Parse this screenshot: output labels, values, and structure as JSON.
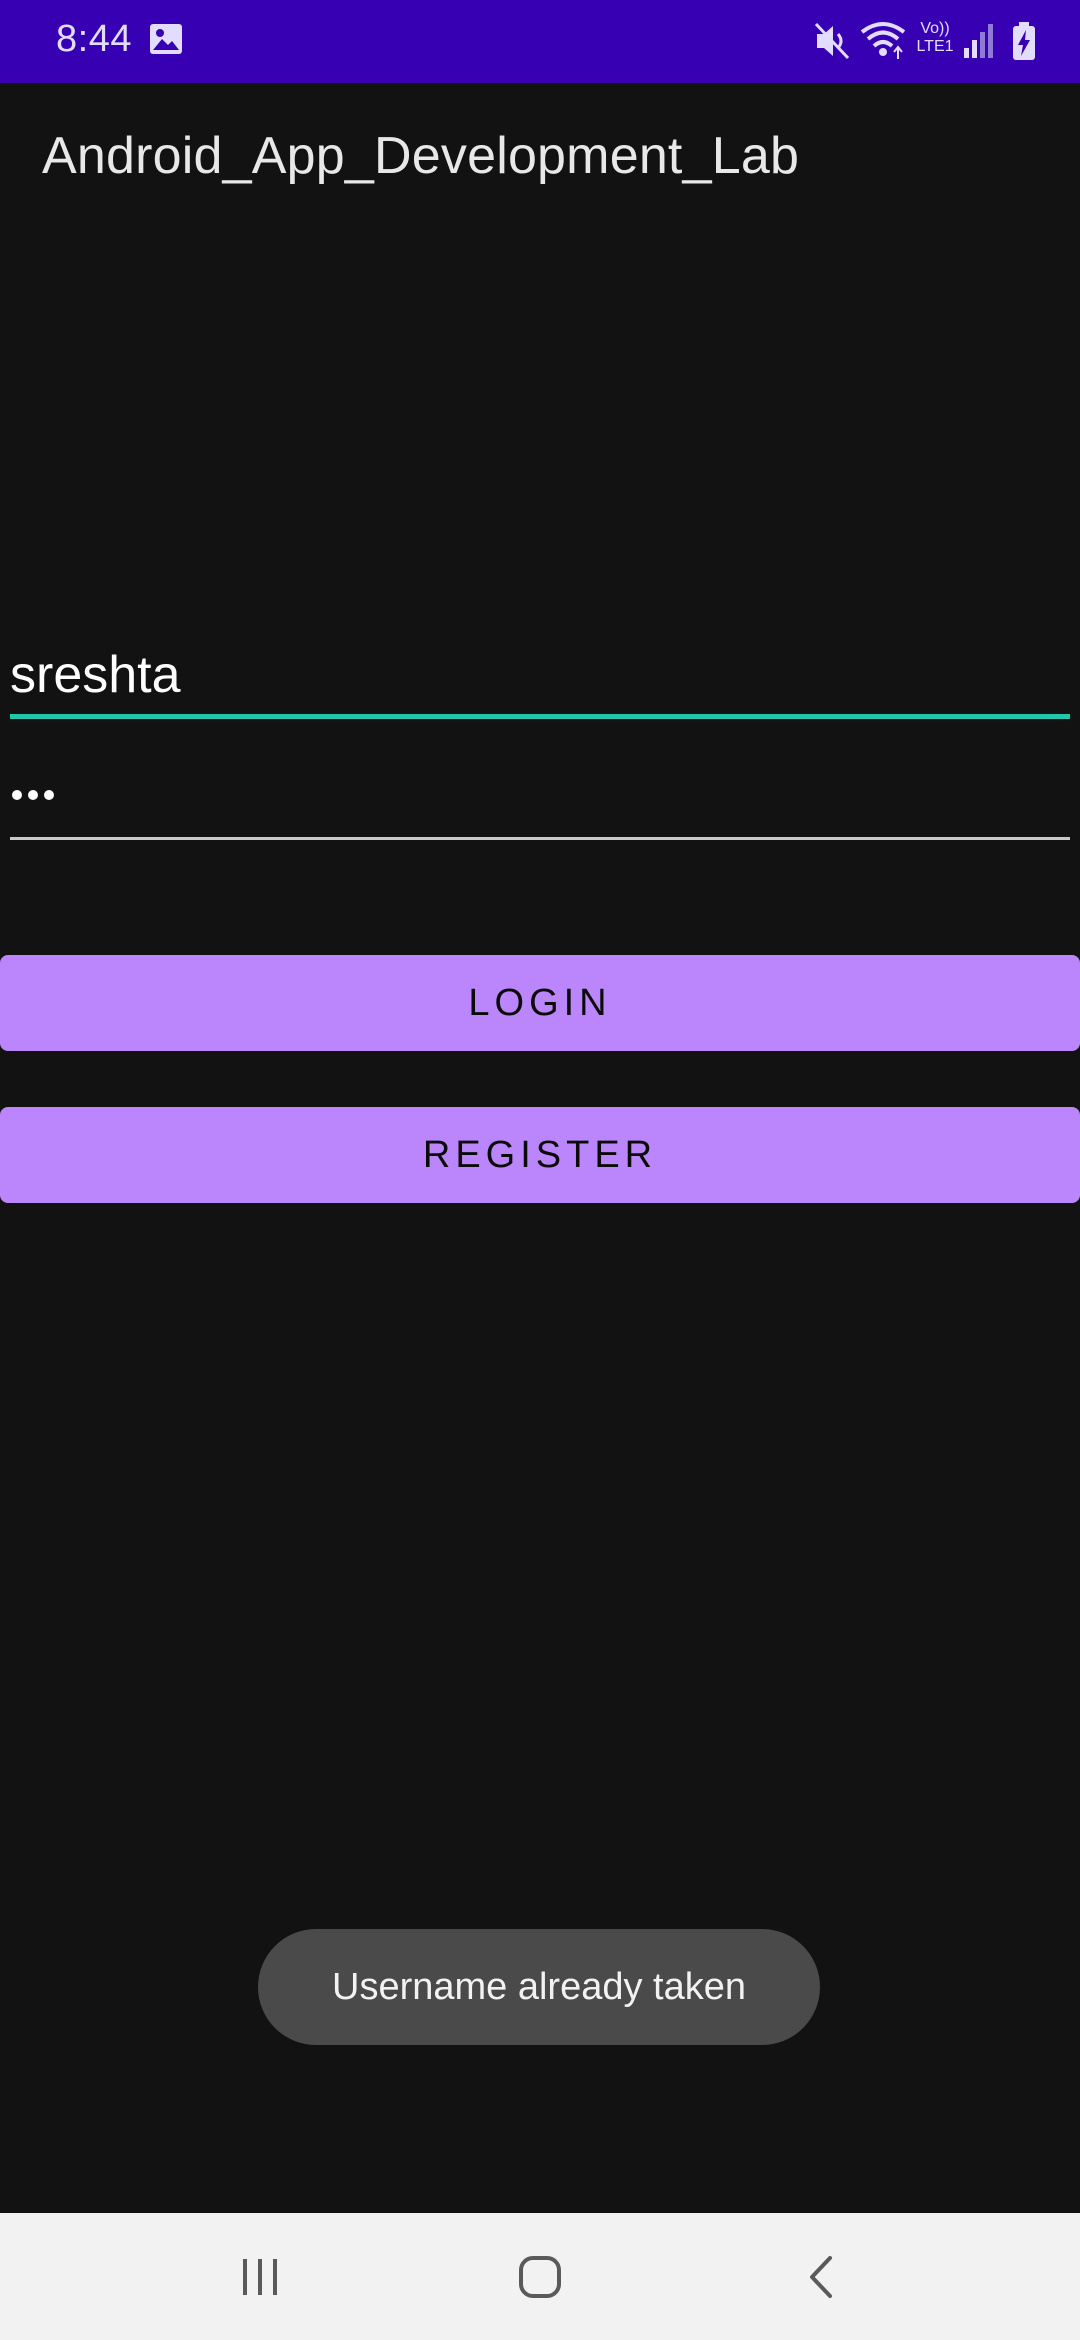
{
  "status_bar": {
    "time": "8:44",
    "icons": [
      "gallery-icon",
      "mute-icon",
      "wifi-icon",
      "volte-lte-icon",
      "signal-icon",
      "battery-charging-icon"
    ],
    "network_label_top": "Vo))",
    "network_label_bottom": "LTE1",
    "color": "#3700b3"
  },
  "app": {
    "title": "Android_App_Development_Lab"
  },
  "form": {
    "username_value": "sreshta",
    "password_masked": "•••",
    "password_length": 3,
    "accent_color": "#21c7a8"
  },
  "buttons": {
    "login_label": "LOGIN",
    "register_label": "REGISTER",
    "color": "#bb86fc"
  },
  "toast": {
    "message": "Username already taken"
  },
  "nav_bar": {
    "icons": [
      "recents-icon",
      "home-icon",
      "back-icon"
    ]
  }
}
